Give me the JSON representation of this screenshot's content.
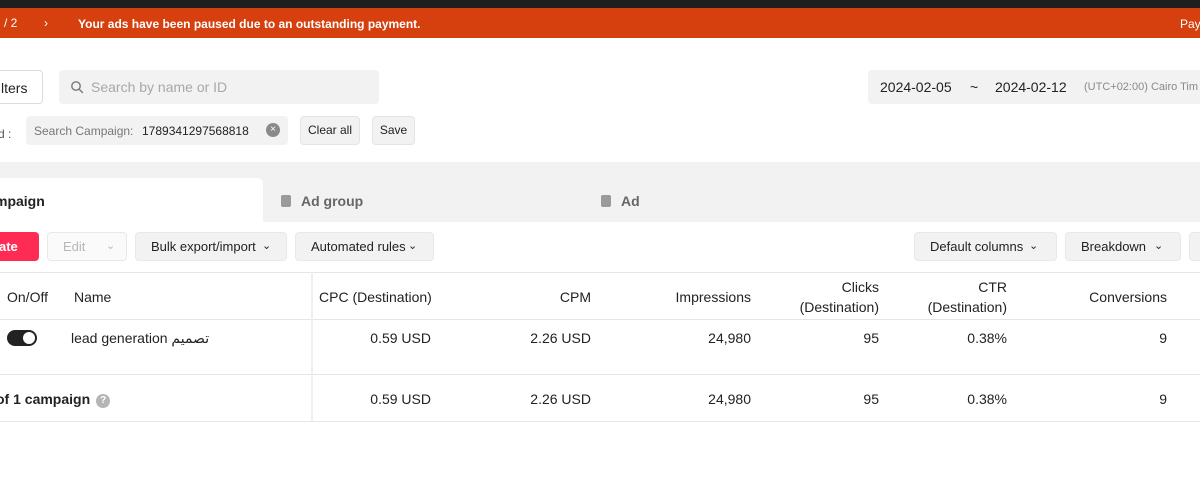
{
  "banner": {
    "pager": "/  2",
    "chevron": "›",
    "message": "Your ads have been paused due to an outstanding payment.",
    "pay_link": "Pay"
  },
  "toolbar": {
    "filters_label": "lters",
    "search_placeholder": "Search by name or ID",
    "date_start": "2024-02-05",
    "date_sep": "~",
    "date_end": "2024-02-12",
    "timezone": "(UTC+02:00) Cairo Tim"
  },
  "filters": {
    "applied_label": "d :",
    "chip_key": "Search Campaign:",
    "chip_value": "1789341297568818",
    "chip_remove": "×",
    "clear_all": "Clear all",
    "save": "Save"
  },
  "tabs": {
    "campaign": "mpaign",
    "ad_group": "Ad group",
    "ad": "Ad"
  },
  "actions": {
    "create": "ate",
    "edit": "Edit",
    "bulk": "Bulk export/import",
    "automated": "Automated rules",
    "default_columns": "Default columns",
    "breakdown": "Breakdown",
    "chevron": "⌄"
  },
  "table": {
    "headers": {
      "onoff": "On/Off",
      "name": "Name",
      "cpc": "CPC (Destination)",
      "cpm": "CPM",
      "impressions": "Impressions",
      "clicks_1": "Clicks",
      "clicks_2": "(Destination)",
      "ctr_1": "CTR",
      "ctr_2": "(Destination)",
      "conversions": "Conversions"
    },
    "rows": [
      {
        "toggle_on": true,
        "name": "lead generation تصميم",
        "cpc": "0.59 USD",
        "cpm": "2.26 USD",
        "impressions": "24,980",
        "clicks": "95",
        "ctr": "0.38%",
        "conversions": "9"
      }
    ],
    "total": {
      "label": "of 1 campaign",
      "help": "?",
      "cpc": "0.59 USD",
      "cpm": "2.26 USD",
      "impressions": "24,980",
      "clicks": "95",
      "ctr": "0.38%",
      "conversions": "9"
    }
  },
  "colors": {
    "banner_bg": "#d6400f",
    "create_bg": "#fe2c55",
    "topbar": "#1f1f1f"
  }
}
